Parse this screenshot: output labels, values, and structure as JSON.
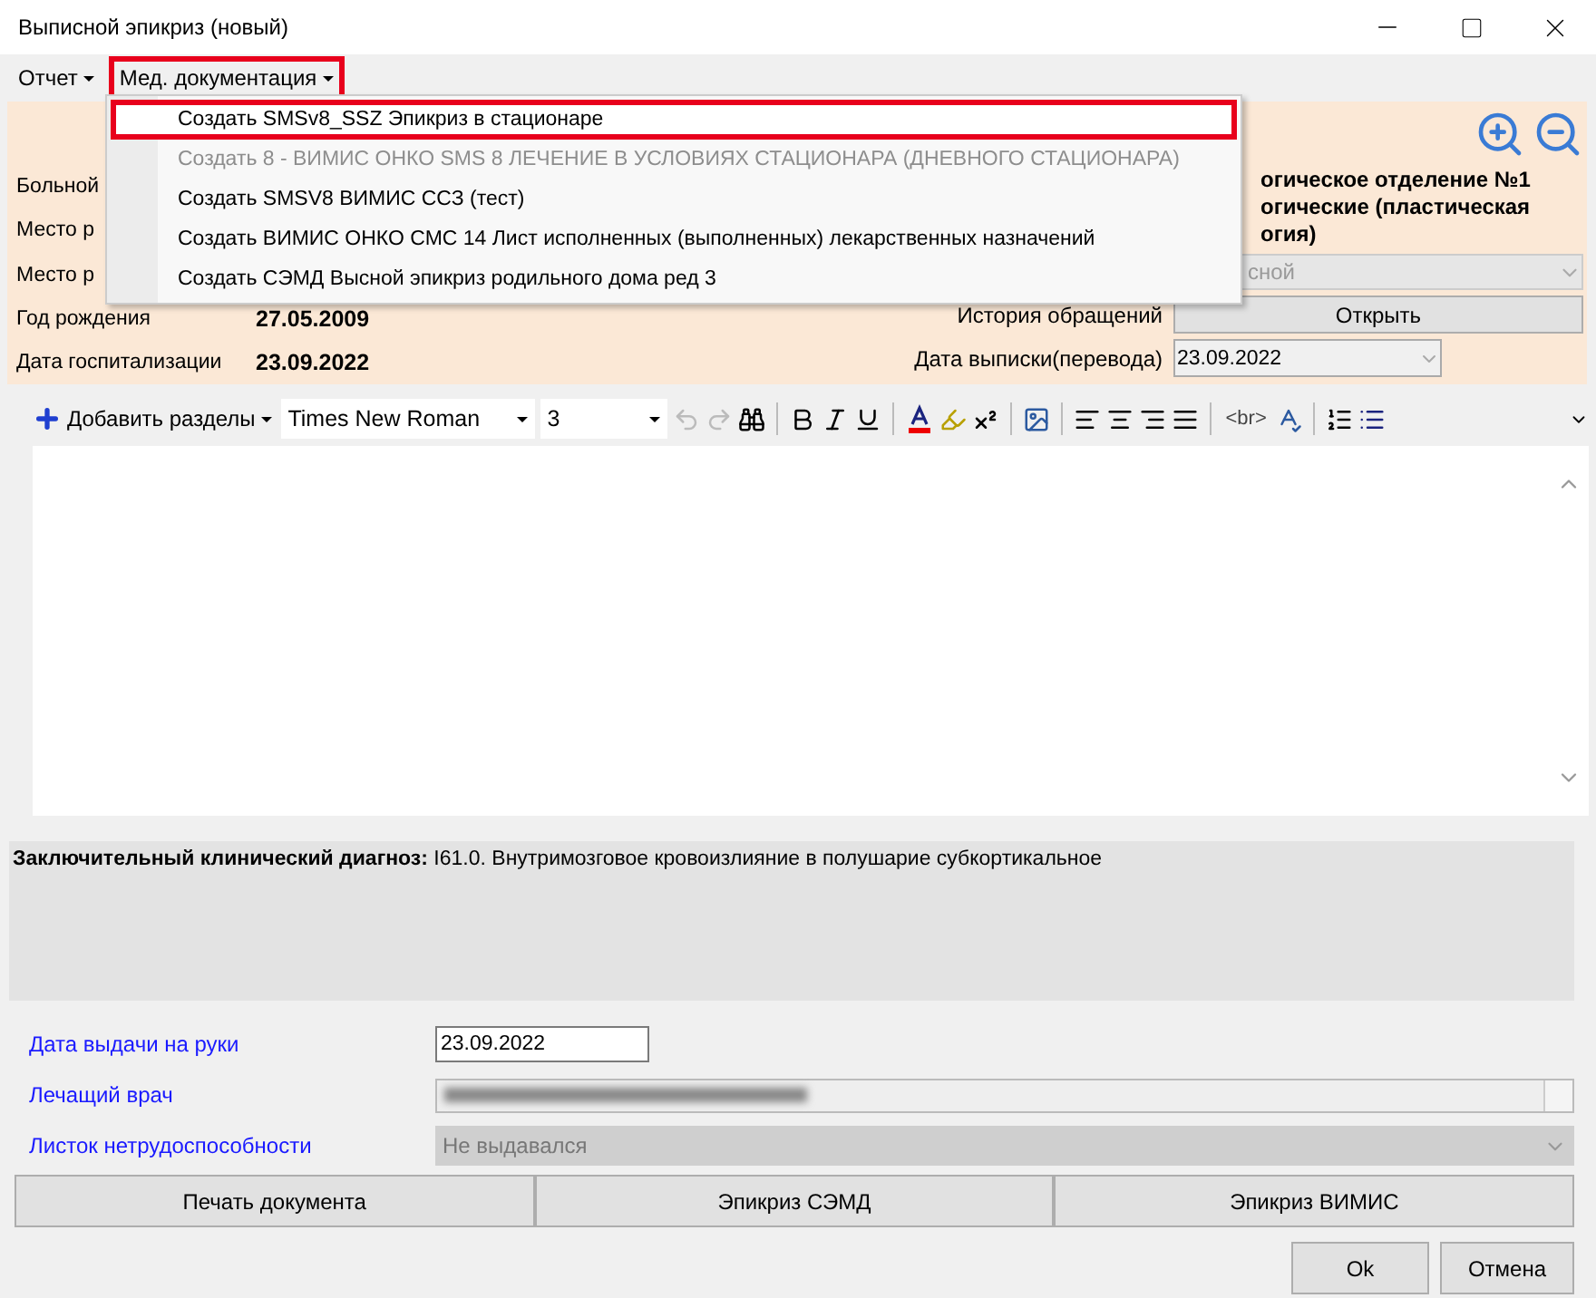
{
  "window": {
    "title": "Выписной эпикриз (новый)"
  },
  "menu": [
    {
      "label": "Отчет",
      "highlighted": false
    },
    {
      "label": "Мед. документация",
      "highlighted": true
    }
  ],
  "dropdown": [
    {
      "label": "Создать SMSv8_SSZ Эпикриз в стационаре",
      "disabled": false,
      "highlighted": true
    },
    {
      "label": "Создать 8 - ВИМИС ОНКО SMS 8 ЛЕЧЕНИЕ В УСЛОВИЯХ СТАЦИОНАРА (ДНЕВНОГО СТАЦИОНАРА)",
      "disabled": true,
      "highlighted": false
    },
    {
      "label": "Создать SMSV8 ВИМИС ССЗ (тест)",
      "disabled": false,
      "highlighted": false
    },
    {
      "label": "Создать ВИМИС ОНКО СМС 14 Лист исполненных (выполненных) лекарственных назначений",
      "disabled": false,
      "highlighted": false
    },
    {
      "label": "Создать СЭМД Высной эпикриз родильного дома ред 3",
      "disabled": false,
      "highlighted": false
    }
  ],
  "patient": {
    "fields": [
      {
        "label": "Больной"
      },
      {
        "label": "Место р"
      },
      {
        "label": "Место р"
      },
      {
        "label": "Год рождения",
        "value": "27.05.2009"
      },
      {
        "label": "Дата госпитализации",
        "value": "23.09.2022"
      }
    ],
    "department": [
      "огическое отделение №1",
      "огические (пластическая",
      "огия)"
    ],
    "combo": {
      "value": "сной",
      "disabled": true
    },
    "history": {
      "label": "История обращений",
      "button": "Открыть"
    },
    "discharge": {
      "label": "Дата выписки(перевода)",
      "value": "23.09.2022"
    }
  },
  "toolbar": {
    "add_sections": "Добавить разделы",
    "font": "Times New Roman",
    "size": "3",
    "br_label": "<br>"
  },
  "diagnosis": "**Заключительный клинический диагноз:** I61.0. Внутримозговое кровоизлияние в полушарие субкортикальное",
  "bottom_fields": [
    {
      "kind": "date",
      "label": "Дата выдачи на руки",
      "value": "23.09.2022"
    },
    {
      "kind": "redacted",
      "label": "Лечащий врач"
    },
    {
      "kind": "combo",
      "label": "Листок нетрудоспособности",
      "value": "Не выдавался",
      "disabled": true
    }
  ],
  "actions": [
    "Печать документа",
    "Эпикриз СЭМД",
    "Эпикриз ВИМИС"
  ],
  "dialog_buttons": [
    "Ok",
    "Отмена"
  ]
}
